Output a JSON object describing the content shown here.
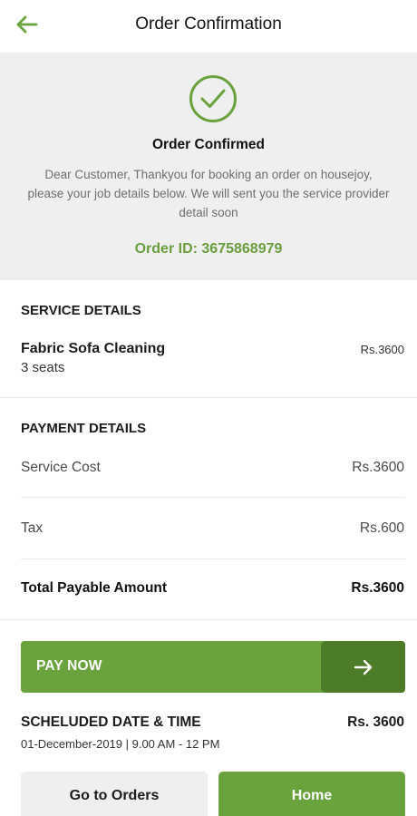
{
  "header": {
    "title": "Order Confirmation",
    "back_icon": "arrow-left-icon"
  },
  "confirmation": {
    "icon": "check-circle-icon",
    "title": "Order Confirmed",
    "message": "Dear Customer, Thankyou for booking an order on housejoy, please your job details below. We will sent you the service provider detail soon",
    "order_id": "Order ID: 3675868979"
  },
  "service_details": {
    "title": "SERVICE DETAILS",
    "items": [
      {
        "name": "Fabric Sofa Cleaning",
        "qty": "3 seats",
        "price": "Rs.3600"
      }
    ]
  },
  "payment_details": {
    "title": "PAYMENT DETAILS",
    "rows": [
      {
        "label": "Service Cost",
        "value": "Rs.3600"
      },
      {
        "label": "Tax",
        "value": "Rs.600"
      }
    ],
    "total": {
      "label": "Total Payable Amount",
      "value": "Rs.3600"
    }
  },
  "pay_now": {
    "label": "PAY NOW",
    "icon": "arrow-right-icon"
  },
  "schedule": {
    "title": "SCHELUDED DATE & TIME",
    "amount": "Rs. 3600",
    "datetime": "01-December-2019 | 9.00 AM - 12 PM"
  },
  "actions": {
    "orders_label": "Go to Orders",
    "home_label": "Home"
  },
  "colors": {
    "accent": "#6aa23d",
    "accent_dark": "#4d7c28",
    "panel_bg": "#efefef"
  }
}
